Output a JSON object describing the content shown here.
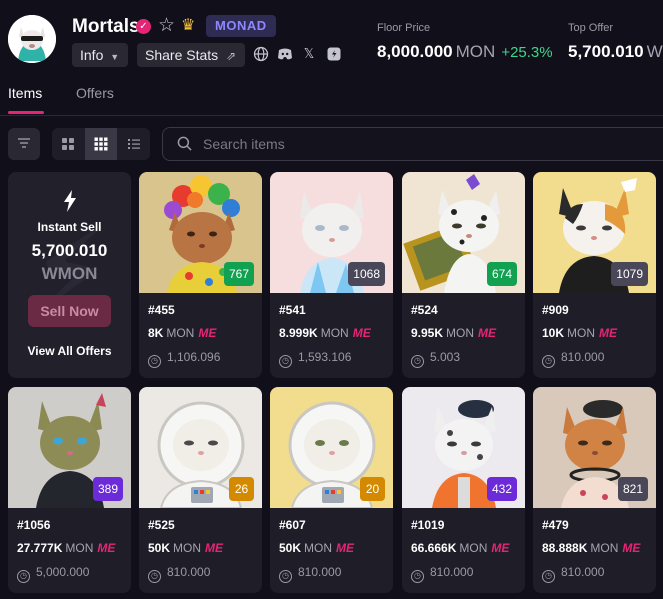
{
  "collection": {
    "name": "Mortals",
    "chain": "MONAD",
    "info_label": "Info",
    "share_label": "Share Stats"
  },
  "stats": {
    "floor_label": "Floor Price",
    "floor_value": "8,000.000",
    "floor_unit": "MON",
    "floor_change": "+25.3%",
    "top_offer_label": "Top Offer",
    "top_offer_value": "5,700.010",
    "top_offer_unit": "W"
  },
  "tabs": {
    "items": "Items",
    "offers": "Offers"
  },
  "search": {
    "placeholder": "Search items"
  },
  "instant_sell": {
    "label": "Instant Sell",
    "value": "5,700.010",
    "currency": "WMON",
    "button": "Sell Now",
    "view_all": "View All Offers"
  },
  "currency": "MON",
  "marketplace_mark": "ME",
  "colors": {
    "accent": "#e42575",
    "positive": "#3dd68c",
    "chain_badge": "#8e87ff",
    "rank_green": "#12a150",
    "rank_gray": "#4a4858",
    "rank_purple": "#6c2bd9",
    "rank_orange": "#d48a00"
  },
  "items": [
    {
      "id": "#455",
      "price": "8K",
      "offer": "1,106.096",
      "rank": "767",
      "rank_color": "#12a150"
    },
    {
      "id": "#541",
      "price": "8.999K",
      "offer": "1,593.106",
      "rank": "1068",
      "rank_color": "#4a4858"
    },
    {
      "id": "#524",
      "price": "9.95K",
      "offer": "5.003",
      "rank": "674",
      "rank_color": "#12a150"
    },
    {
      "id": "#909",
      "price": "10K",
      "offer": "810.000",
      "rank": "1079",
      "rank_color": "#4a4858"
    },
    {
      "id": "#1056",
      "price": "27.777K",
      "offer": "5,000.000",
      "rank": "389",
      "rank_color": "#6c2bd9"
    },
    {
      "id": "#525",
      "price": "50K",
      "offer": "810.000",
      "rank": "26",
      "rank_color": "#d48a00"
    },
    {
      "id": "#607",
      "price": "50K",
      "offer": "810.000",
      "rank": "20",
      "rank_color": "#d48a00"
    },
    {
      "id": "#1019",
      "price": "66.666K",
      "offer": "810.000",
      "rank": "432",
      "rank_color": "#6c2bd9"
    },
    {
      "id": "#479",
      "price": "88.888K",
      "offer": "810.000",
      "rank": "821",
      "rank_color": "#4a4858"
    }
  ]
}
